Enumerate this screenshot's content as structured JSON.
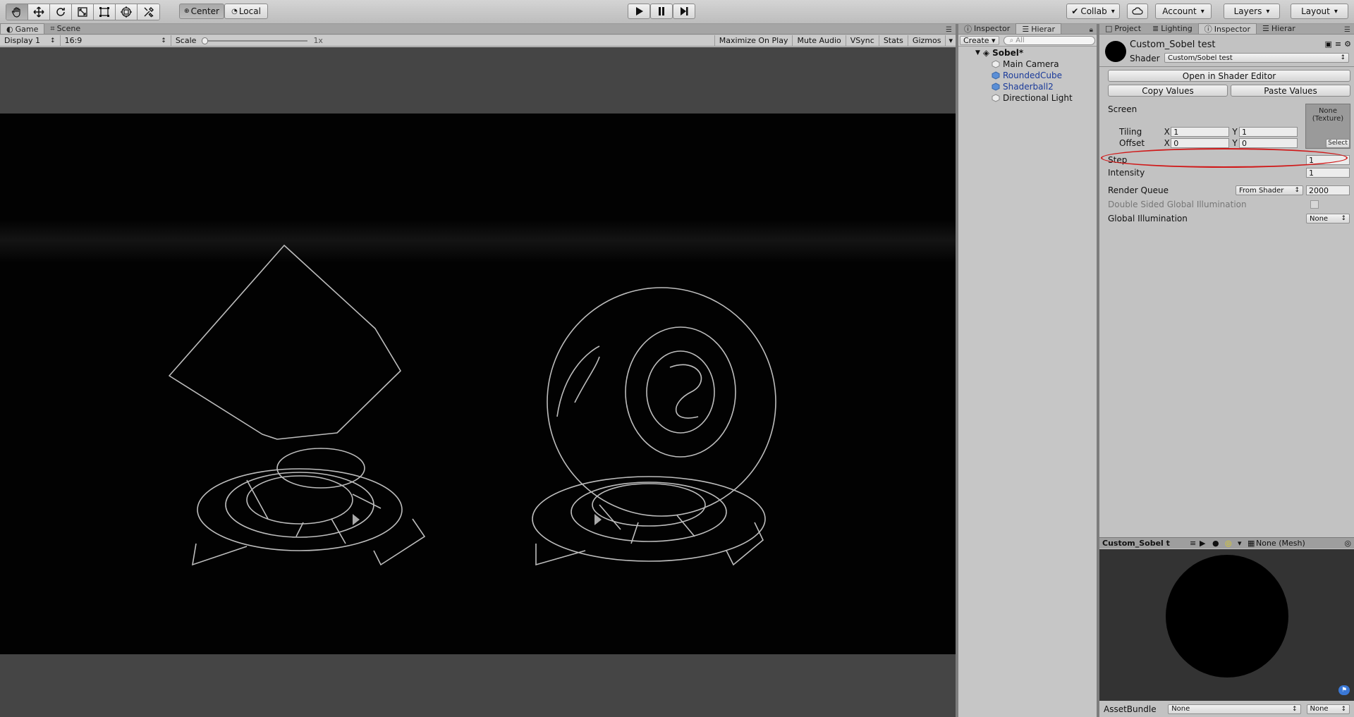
{
  "toolbar": {
    "tools": [
      "hand-icon",
      "move-icon",
      "rotate-icon",
      "scale-icon",
      "rect-icon",
      "transform-icon",
      "custom-tool-icon"
    ],
    "pivot_label": "Center",
    "space_label": "Local",
    "collab_label": "Collab",
    "account_label": "Account",
    "layers_label": "Layers",
    "layout_label": "Layout"
  },
  "game_panel": {
    "tab_game": "Game",
    "tab_scene": "Scene",
    "display": "Display 1",
    "aspect": "16:9",
    "scale_label": "Scale",
    "scale_value": "1x",
    "maximize": "Maximize On Play",
    "mute": "Mute Audio",
    "vsync": "VSync",
    "stats": "Stats",
    "gizmos": "Gizmos"
  },
  "hierarchy": {
    "tab_inspector": "Inspector",
    "tab_hierarchy": "Hierar",
    "create": "Create",
    "search_placeholder": "All",
    "scene": "Sobel*",
    "items": [
      {
        "label": "Main Camera",
        "prefab": false
      },
      {
        "label": "RoundedCube",
        "prefab": true
      },
      {
        "label": "Shaderball2",
        "prefab": true
      },
      {
        "label": "Directional Light",
        "prefab": false
      }
    ]
  },
  "inspector": {
    "tabs": [
      "Project",
      "Lighting",
      "Inspector",
      "Hierar"
    ],
    "material_name": "Custom_Sobel test",
    "shader_label": "Shader",
    "shader_value": "Custom/Sobel test",
    "open_shader_editor": "Open in Shader Editor",
    "copy_values": "Copy Values",
    "paste_values": "Paste Values",
    "screen_label": "Screen",
    "texture_none": "None",
    "texture_type": "(Texture)",
    "select": "Select",
    "tiling_label": "Tiling",
    "offset_label": "Offset",
    "x": "X",
    "y": "Y",
    "tiling_x": "1",
    "tiling_y": "1",
    "offset_x": "0",
    "offset_y": "0",
    "step_label": "Step",
    "step_value": "1",
    "intensity_label": "Intensity",
    "intensity_value": "1",
    "render_queue_label": "Render Queue",
    "render_queue_mode": "From Shader",
    "render_queue_value": "2000",
    "double_sided_label": "Double Sided Global Illumination",
    "gi_label": "Global Illumination",
    "gi_value": "None",
    "preview_title": "Custom_Sobel t",
    "preview_mesh": "None (Mesh)",
    "assetbundle_label": "AssetBundle",
    "assetbundle_value": "None",
    "assetbundle_variant": "None"
  }
}
